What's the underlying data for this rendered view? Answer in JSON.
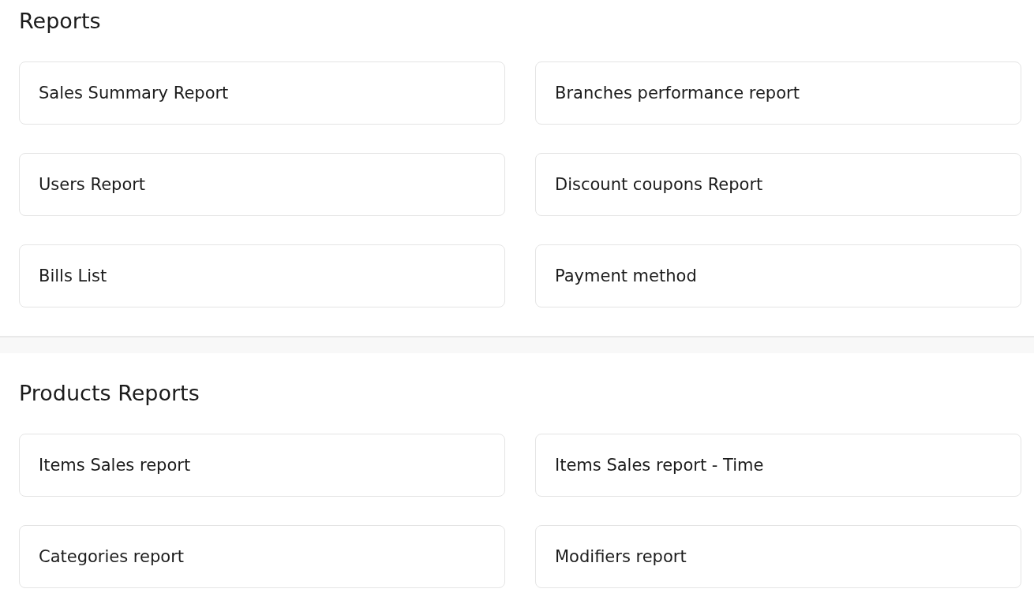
{
  "sections": [
    {
      "title": "Reports",
      "items": [
        "Sales Summary Report",
        "Branches performance report",
        "Users Report",
        "Discount coupons Report",
        "Bills List",
        "Payment method"
      ]
    },
    {
      "title": "Products Reports",
      "items": [
        "Items Sales report",
        "Items Sales report - Time",
        "Categories report",
        "Modifiers report"
      ]
    }
  ]
}
